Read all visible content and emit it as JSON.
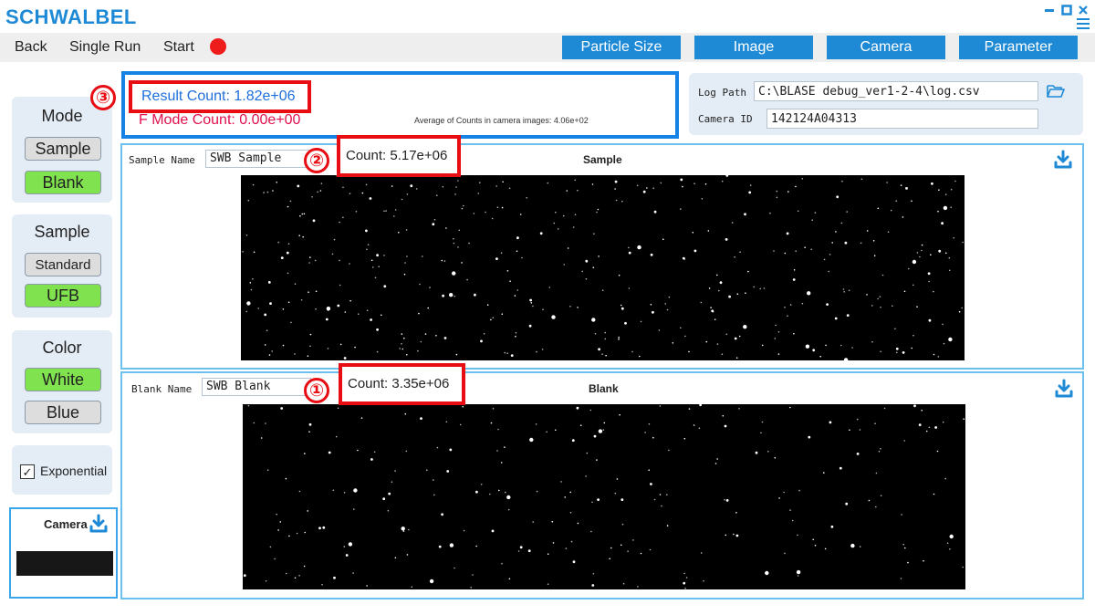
{
  "app": {
    "title": "SCHWALBEL",
    "colors": {
      "accent": "#1e8ad6",
      "active": "#7fe24e",
      "highlight": "#e80c13",
      "fmode": "#e0104d"
    }
  },
  "window_controls": [
    {
      "name": "minimize",
      "icon": "minimize-icon"
    },
    {
      "name": "maximize",
      "icon": "maximize-icon"
    },
    {
      "name": "close",
      "icon": "close-icon"
    },
    {
      "name": "menu",
      "icon": "hamburger-menu-icon"
    }
  ],
  "menubar": {
    "back": "Back",
    "single_run": "Single Run",
    "start": "Start",
    "status_icon": "record-status-icon"
  },
  "tabs": [
    "Particle Size",
    "Image",
    "Camera",
    "Parameter"
  ],
  "sidebar": {
    "mode": {
      "title": "Mode",
      "options": [
        "Sample",
        "Blank"
      ],
      "selected": "Blank"
    },
    "sample": {
      "title": "Sample",
      "options": [
        "Standard",
        "UFB"
      ],
      "selected": "UFB"
    },
    "color": {
      "title": "Color",
      "options": [
        "White",
        "Blue"
      ],
      "selected": "White"
    },
    "exponential": {
      "label": "Exponential",
      "checked": true,
      "check_mark": "✓"
    },
    "camera": {
      "title": "Camera",
      "icon": "download-icon"
    }
  },
  "result": {
    "result_count": "Result Count: 1.82e+06",
    "f_mode_count": "F Mode Count: 0.00e+00",
    "average": "Average of Counts in camera images: 4.06e+02"
  },
  "log": {
    "log_path_label": "Log Path",
    "log_path_value": "C:\\BLASE debug_ver1-2-4\\log.csv",
    "camera_id_label": "Camera ID",
    "camera_id_value": "142124A04313",
    "folder_icon": "folder-open-icon"
  },
  "sample_panel": {
    "name_label": "Sample Name",
    "name_value": "SWB Sample",
    "count": "Count: 5.17e+06",
    "title": "Sample",
    "icon": "download-icon"
  },
  "blank_panel": {
    "name_label": "Blank Name",
    "name_value": "SWB Blank",
    "count": "Count: 3.35e+06",
    "title": "Blank",
    "icon": "download-icon"
  },
  "annotations": [
    "③",
    "②",
    "①"
  ]
}
